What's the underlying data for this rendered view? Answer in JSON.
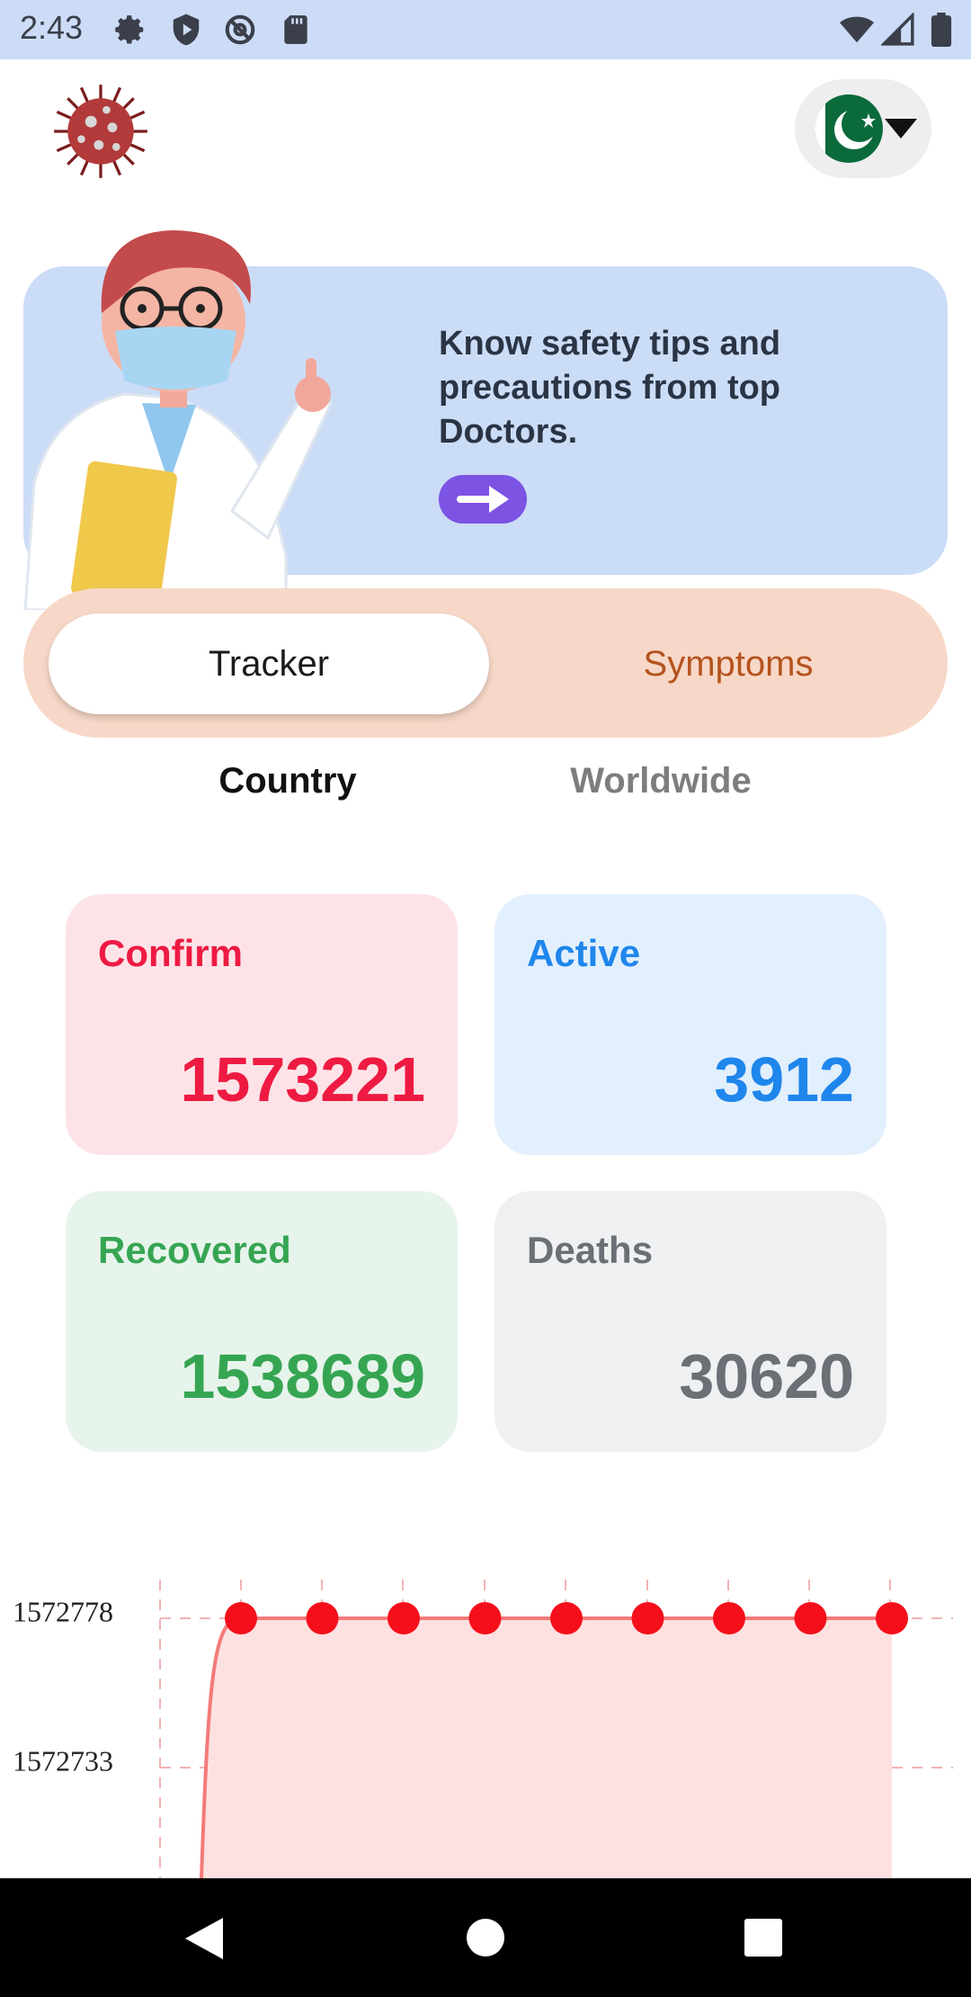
{
  "status_bar": {
    "time": "2:43",
    "left_icons": [
      "gear-icon",
      "shield-icon",
      "at-sign-icon",
      "sd-card-icon"
    ],
    "right_icons": [
      "wifi-icon",
      "signal-icon",
      "battery-icon"
    ]
  },
  "header": {
    "logo_icon": "virus-icon",
    "country_flag": "pakistan-flag-icon",
    "dropdown_icon": "caret-down-icon"
  },
  "banner": {
    "text": "Know safety tips and precautions from top Doctors.",
    "arrow_icon": "arrow-right-icon",
    "background": "#cbdcf7",
    "button_color": "#7c53e3"
  },
  "segment_tabs": {
    "tracker_label": "Tracker",
    "symptoms_label": "Symptoms",
    "selected": "Tracker"
  },
  "sub_tabs": {
    "country_label": "Country",
    "worldwide_label": "Worldwide",
    "selected": "Country"
  },
  "stats": {
    "confirm": {
      "label": "Confirm",
      "value": "1573221",
      "color": "#ee1a42"
    },
    "active": {
      "label": "Active",
      "value": "3912",
      "color": "#1f86ec"
    },
    "recovered": {
      "label": "Recovered",
      "value": "1538689",
      "color": "#36a552"
    },
    "deaths": {
      "label": "Deaths",
      "value": "30620",
      "color": "#6b6f76"
    }
  },
  "chart_data": {
    "type": "area",
    "y_tick_labels": [
      "1572778",
      "1572733"
    ],
    "series": [
      {
        "values": [
          1572778,
          1572778,
          1572778,
          1572778,
          1572778,
          1572778,
          1572778,
          1572778,
          1572778
        ],
        "color": "#f50f1a"
      }
    ],
    "grid": true
  },
  "nav_bar": {
    "icons": [
      "back-icon",
      "home-icon",
      "recents-icon"
    ]
  }
}
